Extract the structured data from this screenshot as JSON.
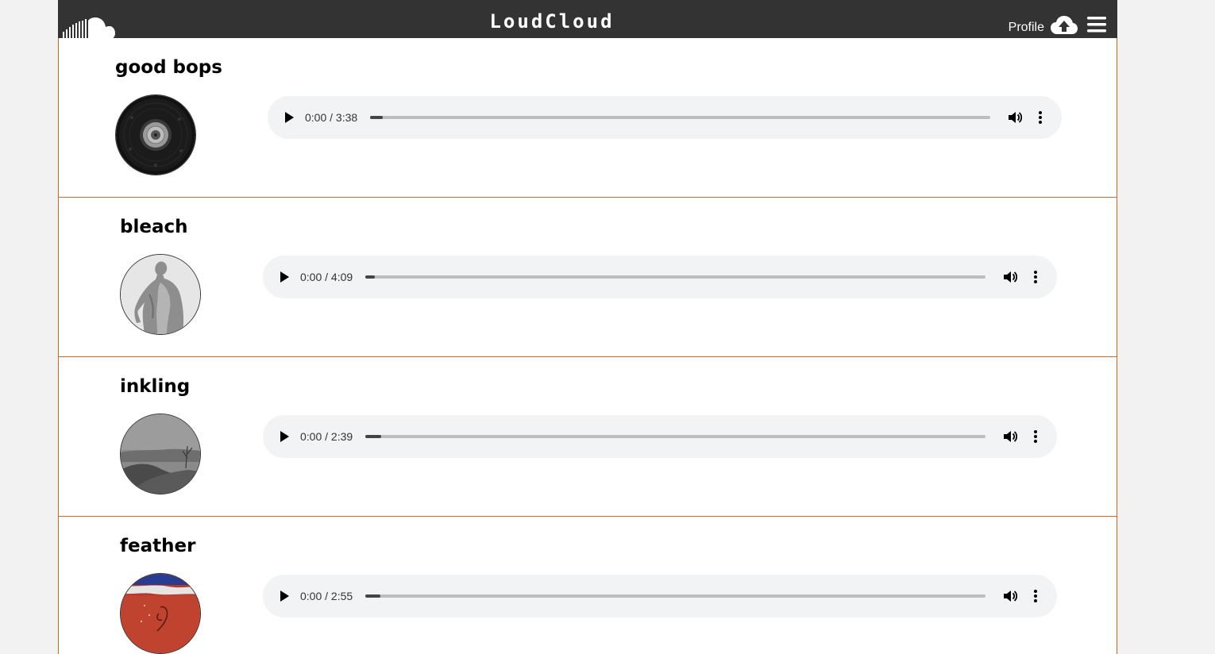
{
  "navbar": {
    "brand": "LoudCloud",
    "profile_label": "Profile",
    "logo_icon": "soundcloud-logo-icon",
    "upload_icon": "cloud-upload-icon",
    "menu_icon": "hamburger-menu-icon"
  },
  "theme": {
    "navbar_bg": "#333333",
    "track_border": "#d2691e",
    "player_bg": "#f1f3f4"
  },
  "tracks": [
    {
      "title": "good bops",
      "time": "0:00 / 3:38",
      "progress": 0.02,
      "cover": "dark vinyl record"
    },
    {
      "title": "bleach",
      "time": "0:00 / 4:09",
      "progress": 0.016,
      "cover": "grey statue"
    },
    {
      "title": "inkling",
      "time": "0:00 / 2:39",
      "progress": 0.025,
      "cover": "grey hillside landscape"
    },
    {
      "title": "feather",
      "time": "0:00 / 2:55",
      "progress": 0.024,
      "cover": "red painted canvas"
    }
  ]
}
